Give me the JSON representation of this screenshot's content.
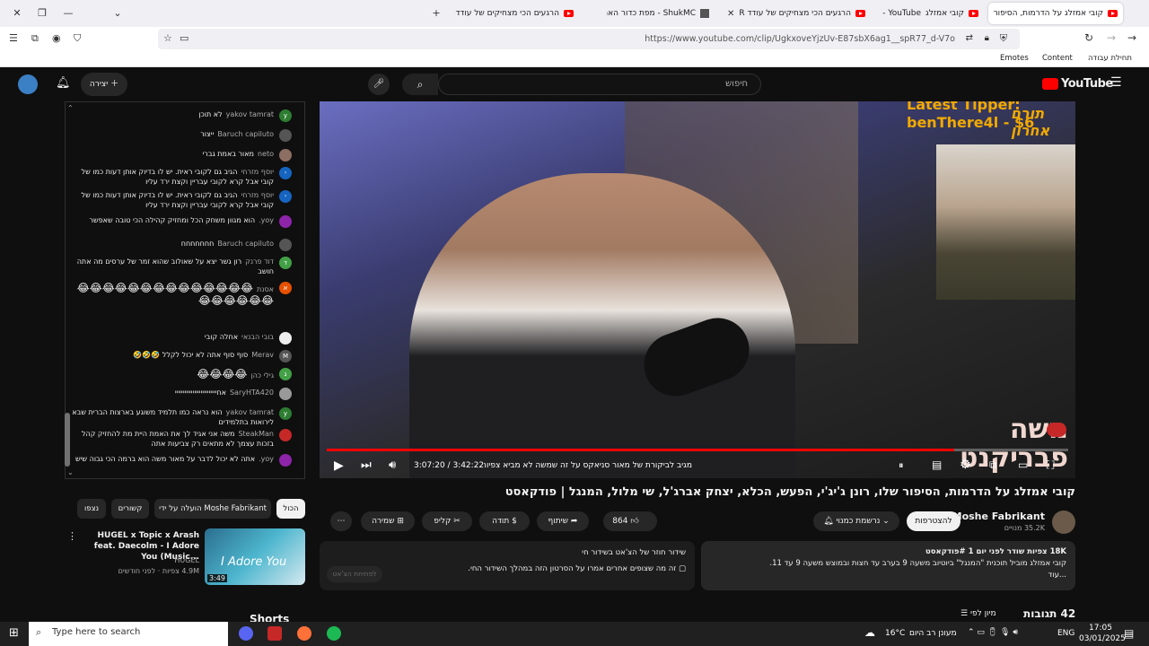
{
  "browser": {
    "tabs": [
      {
        "title": "קובי אמזלג על הדרמות, הסיפור",
        "active": true
      },
      {
        "title": "קובי אמזלג",
        "prefix": "YouTube - "
      },
      {
        "title": "הרגעים הכי מצחיקים של עודד R"
      },
      {
        "title": "ShukMC - מפת כדור הארץ"
      },
      {
        "title": "הרגעים הכי מצחיקים של עודד R"
      }
    ],
    "url": "https://www.youtube.com/clip/UgkxoveYjzUv-E87sbX6ag1__spR77_d-V7o",
    "bookmarks": {
      "emotes": "Emotes",
      "content": "Content",
      "start": "תחילת עבודה"
    }
  },
  "youtube": {
    "logo": "YouTube",
    "search_placeholder": "חיפוש",
    "create_label": "יצירה"
  },
  "chat": [
    {
      "name": "yakov tamrat",
      "text": "לא תוכן",
      "avatar": "y",
      "color": "#2e7d32"
    },
    {
      "name": "Baruch capiluto",
      "text": "ייצור",
      "avatar": "",
      "color": "#555"
    },
    {
      "name": "neto",
      "text": "מאור באמת גברי",
      "avatar": "",
      "color": "#8d6e63"
    },
    {
      "name": "יוסף מזרחי",
      "text": "הגיב גם לקובי ראית. יש לו בדיוק אותן דעות כמו של קובי אבל קרא לקובי עבריין וקצת ירד עליו",
      "avatar": "י",
      "color": "#1565c0"
    },
    {
      "name": "יוסף מזרחי",
      "text": "הגיב גם לקובי ראית. יש לו בדיוק אותן דעות כמו של קובי אבל קרא לקובי עבריין וקצת ירד עליו",
      "avatar": "י",
      "color": "#1565c0"
    },
    {
      "name": "yoy.",
      "text": "הוא מגוון משחק הכל ומחזיק קהילה הכי טובה שאפשר",
      "avatar": "",
      "color": "#8e24aa"
    },
    {
      "name": "Baruch capiluto",
      "text": "חחחחחחח",
      "avatar": "",
      "color": "#555"
    },
    {
      "name": "דוד פרנק",
      "text": "רון גשר יצא על שאולוב שהוא זמר של ערסים מה אתה חושב",
      "avatar": "ד",
      "color": "#43a047"
    },
    {
      "name": "אסנת",
      "text": "😂😂😂😂😂😂😂😂😂😂😂😂😂😂😂😂😂😂😂😂",
      "avatar": "א",
      "color": "#e65100"
    },
    {
      "name": "בובי הבנאי",
      "text": "אחלה קובי",
      "avatar": "",
      "color": "#eee"
    },
    {
      "name": "Merav",
      "text": "סוף סוף אתה לא יכול לקלל 🤣🤣🤣",
      "avatar": "M",
      "color": "#555"
    },
    {
      "name": "גילי כהן",
      "text": "😂😂😂😂",
      "avatar": "ג",
      "color": "#43a047"
    },
    {
      "name": "SaryHTA420",
      "text": "אחיייייייייייייייייייייייייי",
      "avatar": "",
      "color": "#999"
    },
    {
      "name": "yakov tamrat",
      "text": "הוא נראה כמו תלמיד משוגע בארצות הברית שבא לירואות בתלמידים",
      "avatar": "y",
      "color": "#2e7d32"
    },
    {
      "name": "SteakMan",
      "text": "משה אני אגיד לך את האמת היית מת להחזיק קהל בזכות עצמך לא מתאים רק צביעות אתה",
      "avatar": "",
      "color": "#c62828"
    },
    {
      "name": "yoy.",
      "text": "אתה לא יכול לדבר על מאור משה הוא ברמה הכי גבוה שיש",
      "avatar": "",
      "color": "#8e24aa"
    }
  ],
  "video": {
    "tipper_title": "Latest Tipper:",
    "tipper_name": "benThere4l - $6",
    "tipper_hebrew": "תורם אחרון",
    "logo_text": "משה פבריקנט",
    "time": "3:07:20 / 3:42:22",
    "chapter": "מגיב לביקורת של מאור סניאקס על זה שמשה לא מביא צפיות לבד",
    "progress": 0.846
  },
  "meta": {
    "title": "קובי אמזלג על הדרמות, הסיפור שלו, רונן ג'יג'י, הפעש, הכלא, יצחק אברג'ל, שי מלול, המנגל | פודקאסט",
    "channel": "Moshe Fabrikant",
    "subs": "35.2K מנויים",
    "join": "להצטרפות",
    "subscribed": "נרשמת כמנוי",
    "likes": "864",
    "share": "שיתוף",
    "thanks": "תודה",
    "clip": "קליפ",
    "save": "שמירה"
  },
  "description": {
    "line1": "18K צפיות  שודר לפני יום 1 #פודקאסט",
    "line2": "קובי אמזלג מוביל תוכנית \"המנגל\" ביוטיוב משעה 9 בערב עד חצות ובמוצש משעה 9 עד 11.",
    "more": "...עוד"
  },
  "live_info": {
    "title": "שידור חוזר של הצ'אט בשידור חי",
    "text": "זה מה שצופים אחרים אמרו על הסרטון הזה במהלך השידור החי.",
    "button": "לפתיחת הצ'אט"
  },
  "chips": [
    "הכול",
    "הועלה על ידי Moshe Fabrikant",
    "קשורים",
    "נצפו"
  ],
  "recommendation": {
    "title": "HUGEL x Topic x Arash feat. Daecolm - I Adore You (Music...",
    "channel": "HUGEL",
    "stats": "4.9M צפיות · לפני חודשים",
    "duration": "3:49",
    "thumb_text": "I Adore You"
  },
  "comments": {
    "count": "42 תגובות",
    "sort": "מיון לפי"
  },
  "shorts": "Shorts",
  "taskbar": {
    "search": "Type here to search",
    "weather": "16°C",
    "weather_text": "מעונן רב היום",
    "lang": "ENG",
    "time": "17:05",
    "date": "03/01/2025"
  }
}
